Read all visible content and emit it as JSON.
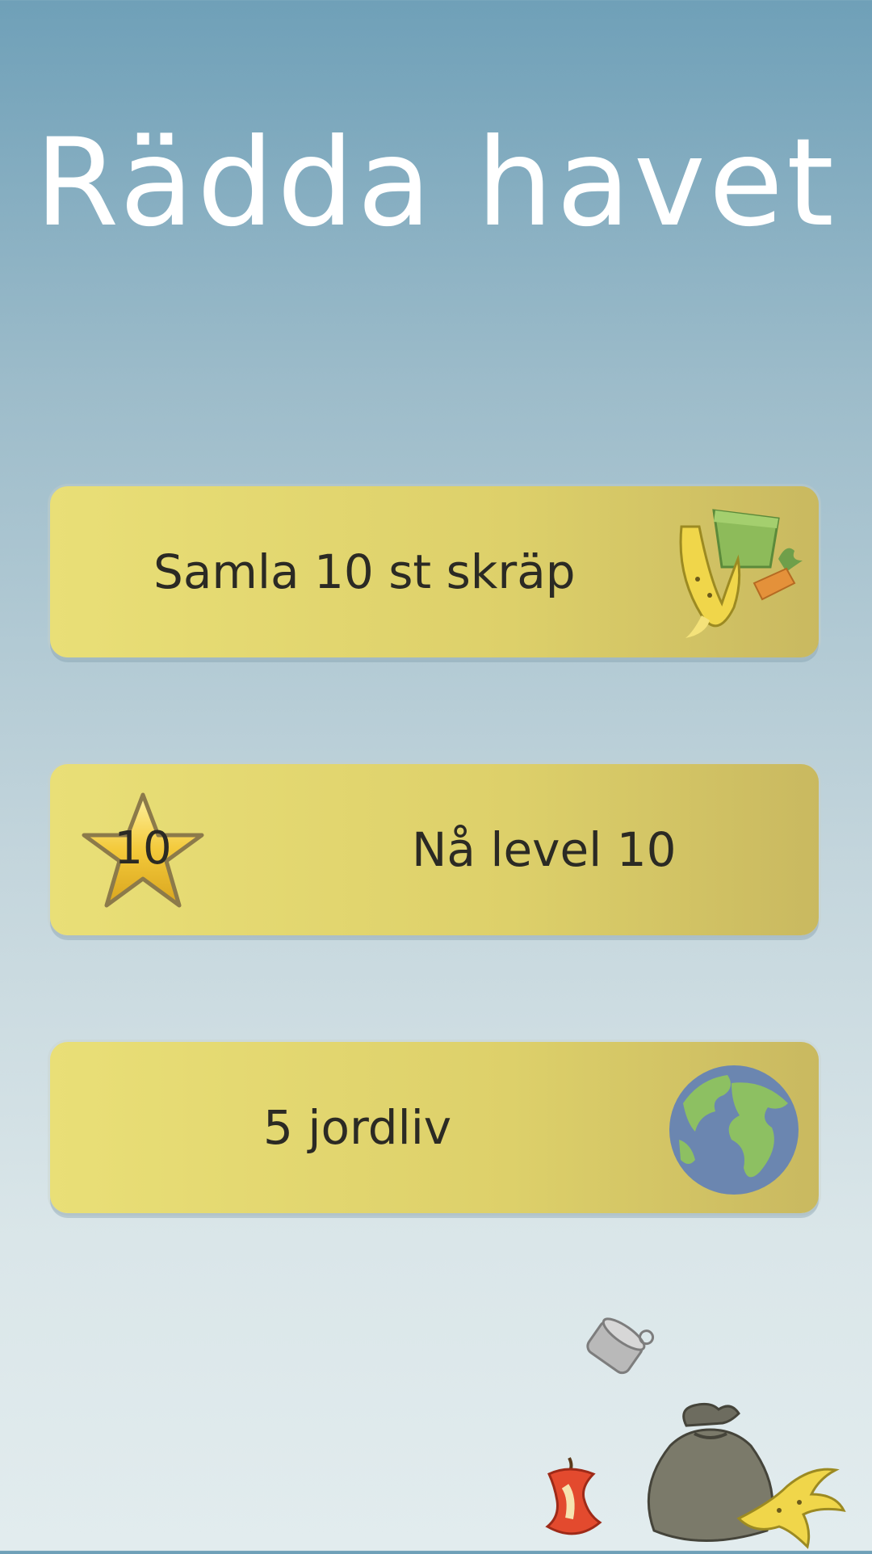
{
  "app": {
    "title": "Rädda havet"
  },
  "goals": [
    {
      "label": "Samla 10 st skräp",
      "icon": "trash-pile-icon"
    },
    {
      "label": "Nå level 10",
      "icon": "star-badge-icon",
      "badge_number": "10"
    },
    {
      "label": "5 jordliv",
      "icon": "earth-globe-icon"
    }
  ],
  "decorations": [
    "tin-can-icon",
    "garbage-bag-icon",
    "apple-core-icon",
    "banana-peel-icon"
  ],
  "colors": {
    "background_top": "#6fa0b8",
    "background_bottom": "#e2ecee",
    "card": "#e3d76f",
    "title_text": "#ffffff",
    "card_text": "#2b2a24"
  }
}
